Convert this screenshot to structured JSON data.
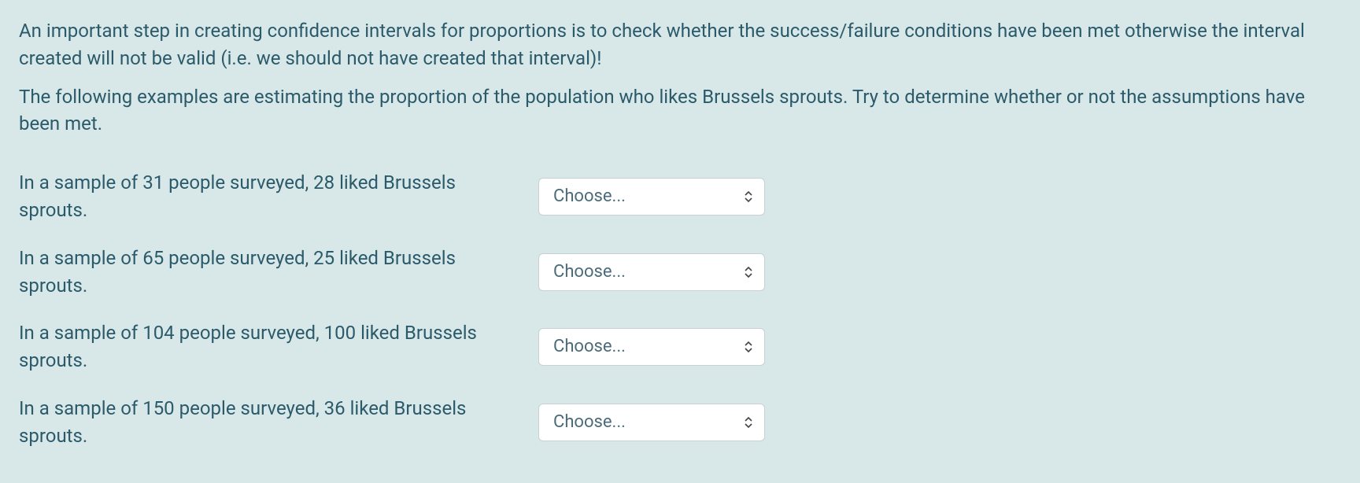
{
  "intro": {
    "paragraph1": "An important step in creating confidence intervals for proportions is to check whether the success/failure conditions have been met otherwise the interval created will not be valid (i.e. we should not have created that interval)!",
    "paragraph2": "The following examples are estimating the proportion of the population who likes Brussels sprouts. Try to determine whether or not the assumptions have been met."
  },
  "questions": [
    {
      "text": "In a sample of 31 people surveyed, 28 liked Brussels sprouts.",
      "selected": "Choose..."
    },
    {
      "text": "In a sample of 65 people surveyed, 25 liked Brussels sprouts.",
      "selected": "Choose..."
    },
    {
      "text": "In a sample of 104 people surveyed, 100 liked Brussels sprouts.",
      "selected": "Choose..."
    },
    {
      "text": "In a sample of 150 people surveyed, 36 liked Brussels sprouts.",
      "selected": "Choose..."
    }
  ]
}
